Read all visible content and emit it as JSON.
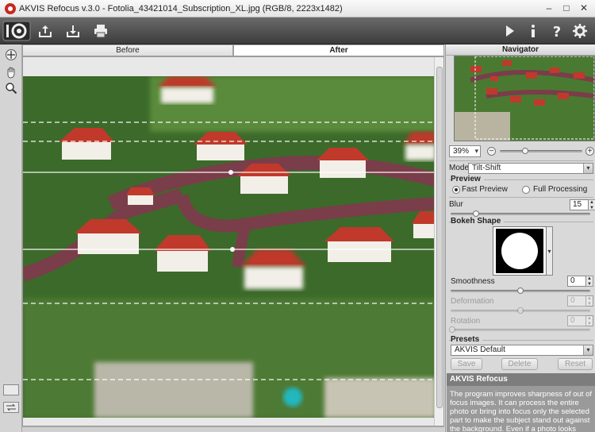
{
  "window": {
    "title": "AKVIS Refocus v.3.0 - Fotolia_43421014_Subscription_XL.jpg (RGB/8, 2223x1482)",
    "minimize_label": "–",
    "maximize_label": "□",
    "close_label": "✕"
  },
  "toolbar": {
    "left_buttons": [
      "logo-icon",
      "open-icon",
      "save-icon",
      "print-icon"
    ],
    "right_buttons": [
      "run-icon",
      "info-icon",
      "help-icon",
      "settings-icon"
    ]
  },
  "tools": [
    "navigator-icon",
    "hand-icon",
    "zoom-icon"
  ],
  "tabs": [
    {
      "label": "Before",
      "active": false
    },
    {
      "label": "After",
      "active": true
    }
  ],
  "navigator": {
    "title": "Navigator",
    "zoom_value": "39%",
    "zoom_out_label": "−",
    "zoom_in_label": "+"
  },
  "settings": {
    "mode_label": "Mode:",
    "mode_value": "Tilt-Shift",
    "preview_title": "Preview",
    "fast_preview_label": "Fast Preview",
    "full_processing_label": "Full Processing",
    "preview_selected": "Fast Preview",
    "blur_label": "Blur",
    "blur_value": "15",
    "blur_level": 0.18,
    "bokeh_title": "Bokeh Shape",
    "smoothness_label": "Smoothness",
    "smoothness_value": "0",
    "deformation_label": "Deformation",
    "deformation_value": "0",
    "rotation_label": "Rotation",
    "rotation_value": "0"
  },
  "presets": {
    "title": "Presets",
    "selected": "AKVIS Default",
    "save_label": "Save",
    "delete_label": "Delete",
    "reset_label": "Reset"
  },
  "help": {
    "title": "AKVIS Refocus",
    "text": "The program improves sharpness of out of focus images. It can process the entire photo or bring into focus only the selected part to make the subject stand out against the background. Even if a photo looks sharp enough, there is"
  },
  "colors": {
    "toolbar_bg": "#4a4a4a",
    "roof_red": "#c0392b",
    "grass_green": "#3f7a2a",
    "road": "#7a3d4a",
    "help_bg": "#9a9a9a"
  }
}
